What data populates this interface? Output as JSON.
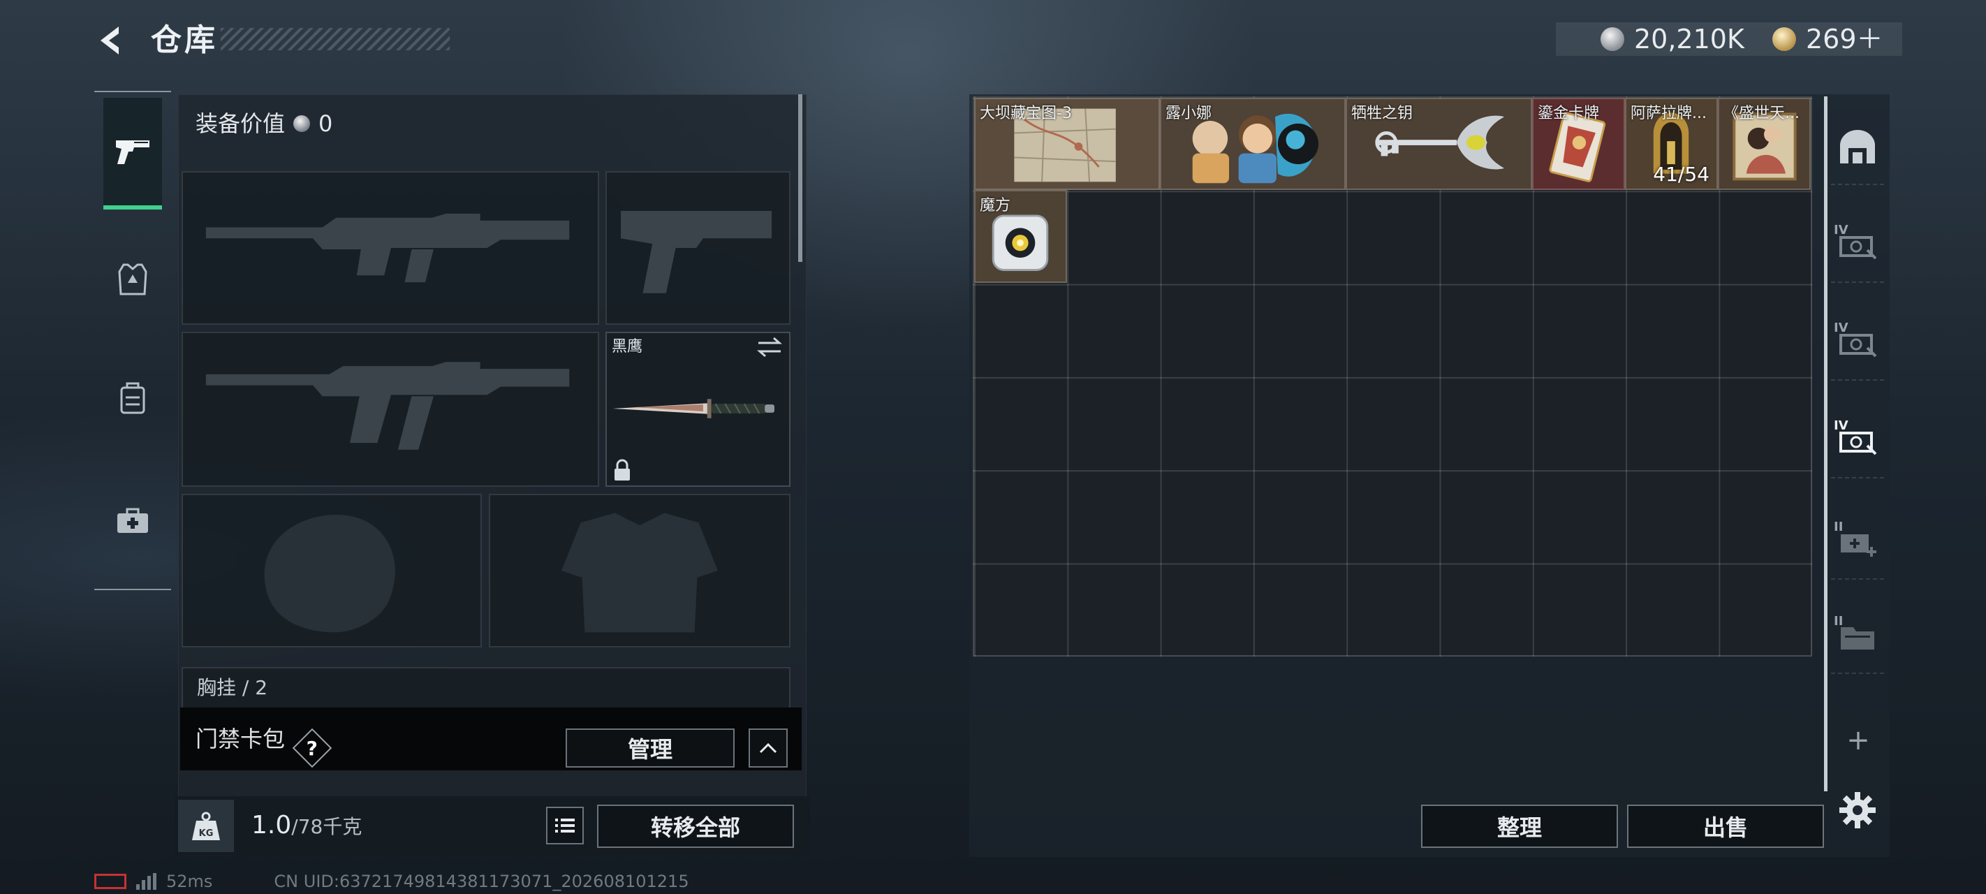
{
  "header": {
    "title": "仓库",
    "silver_amount": "20,210K",
    "gold_amount": "269＋"
  },
  "left_tabs": [
    {
      "name": "weapons",
      "icon": "pistol-icon",
      "active": true
    },
    {
      "name": "armor",
      "icon": "armor-vest-icon"
    },
    {
      "name": "backpack",
      "icon": "backpack-icon"
    },
    {
      "name": "medkit",
      "icon": "medkit-icon"
    }
  ],
  "equipment": {
    "value_label": "装备价值",
    "value": "0",
    "melee_name": "黑鹰",
    "rig_label": "胸挂 / 2"
  },
  "card_pack": {
    "label": "门禁卡包",
    "help": "?",
    "manage_label": "管理"
  },
  "weight": {
    "current": "1.0",
    "max": "/78千克",
    "unit_icon": "KG",
    "transfer_label": "转移全部"
  },
  "status": {
    "ping": "52ms",
    "uid": "CN UID:63721749814381173071_202608101215"
  },
  "storage": {
    "items": [
      {
        "name": "大坝藏宝图-3",
        "icon": "treasure-map-icon"
      },
      {
        "name": "露小娜",
        "icon": "doll-icon"
      },
      {
        "name": "牺牲之钥",
        "icon": "ornate-key-icon"
      },
      {
        "name": "鎏金卡牌",
        "icon": "gilded-card-icon"
      },
      {
        "name": "阿萨拉牌...",
        "icon": "asala-plaque-icon",
        "count": "41/54"
      },
      {
        "name": "《盛世天...",
        "icon": "painting-icon"
      },
      {
        "name": "魔方",
        "icon": "cube-icon"
      }
    ],
    "sort_label": "整理",
    "sell_label": "出售"
  },
  "storage_tabs": [
    {
      "name": "home",
      "icon": "storage-arch-icon"
    },
    {
      "name": "iv-1",
      "label": "IV",
      "icon": "case-icon"
    },
    {
      "name": "iv-2",
      "label": "IV",
      "icon": "case-icon"
    },
    {
      "name": "iv-3",
      "label": "IV",
      "icon": "case-icon",
      "active": true
    },
    {
      "name": "ii-plus",
      "label": "II",
      "icon": "case-plus-icon"
    },
    {
      "name": "ii",
      "label": "II",
      "icon": "folder-case-icon"
    },
    {
      "name": "add",
      "label": "+",
      "icon": "plus-icon"
    },
    {
      "name": "settings",
      "icon": "gear-icon"
    }
  ],
  "colors": {
    "active_tab_accent": "#3fd18d",
    "battery_red": "#c93131"
  }
}
